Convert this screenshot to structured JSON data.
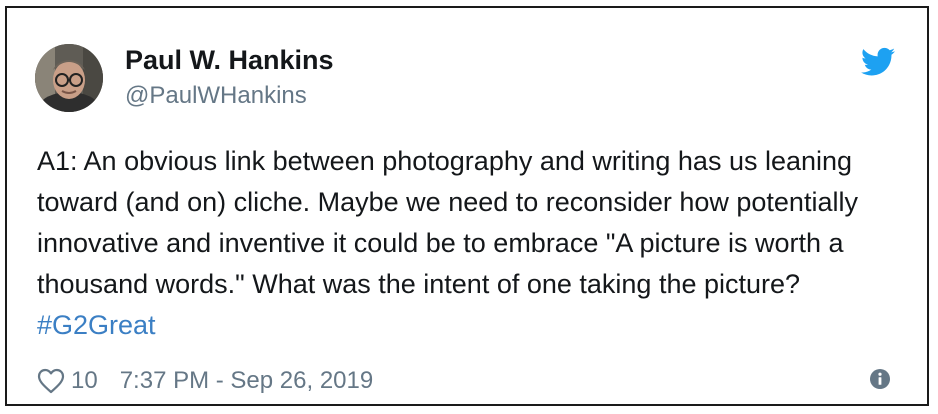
{
  "tweet": {
    "author_name": "Paul W. Hankins",
    "author_handle": "@PaulWHankins",
    "text": "A1: An obvious link between photography and writing has us leaning toward (and on) cliche. Maybe we need to reconsider how potentially innovative and inventive it could be to embrace \"A picture is worth a thousand words.\" What was the intent of one taking the picture? ",
    "hashtag": "#G2Great",
    "like_count": "10",
    "timestamp": "7:37 PM - Sep 26, 2019"
  },
  "icons": {
    "brand": "twitter-bird-icon",
    "like": "heart-outline-icon",
    "info": "info-circle-icon"
  },
  "colors": {
    "twitter_blue": "#1da1f2",
    "hashtag_blue": "#3b7fc4",
    "secondary_text": "#657786",
    "primary_text": "#14171a",
    "card_border": "#1a1a1a"
  }
}
